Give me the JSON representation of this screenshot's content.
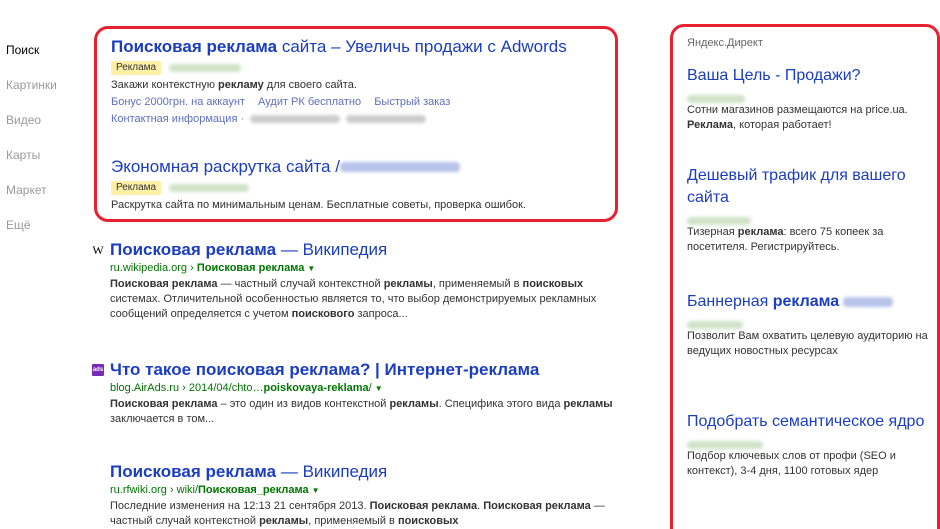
{
  "nav": {
    "items": [
      "Поиск",
      "Картинки",
      "Видео",
      "Карты",
      "Маркет",
      "Ещё"
    ]
  },
  "ads": [
    {
      "title_bold": "Поисковая реклама",
      "title_rest": " сайта – Увеличь продажи с Adwords",
      "badge": "Реклама",
      "text_pre": "Закажи контекстную ",
      "text_bold": "рекламу",
      "text_post": " для своего сайта.",
      "links": [
        "Бонус 2000грн. на аккаунт",
        "Аудит РК бесплатно",
        "Быстрый заказ"
      ],
      "contact": "Контактная информация ·"
    },
    {
      "title_rest": "Экономная раскрутка сайта / ",
      "badge": "Реклама",
      "text_plain": "Раскрутка сайта по минимальным ценам. Бесплатные советы, проверка ошибок."
    }
  ],
  "results": [
    {
      "favicon": "W",
      "title_bold": "Поисковая реклама",
      "title_rest": " — Википедия",
      "url_host": "ru.wikipedia.org",
      "url_sep": " › ",
      "url_path_bold": "Поисковая реклама",
      "snippet_1_bold": "Поисковая реклама",
      "snippet_1": " — частный случай контекстной ",
      "snippet_1b": "рекламы",
      "snippet_1c": ", применяемый в ",
      "snippet_1d": "поисковых",
      "snippet_1e": " системах. Отличительной особенностью является то, что выбор демонстрируемых рекламных сообщений определяется с учетом ",
      "snippet_1f": "поискового",
      "snippet_1g": " запроса..."
    },
    {
      "favicon": "ads",
      "title": "Что такое поисковая реклама? | Интернет-реклама",
      "url_host": "blog.AirAds.ru",
      "url_mid": " › 2014/04/chto…",
      "url_bold": "poiskovaya-reklama",
      "url_end": "/",
      "snippet_a": "Поисковая реклама",
      "snippet_b": " – это один из видов контекстной ",
      "snippet_c": "рекламы",
      "snippet_d": ". Специфика этого вида ",
      "snippet_e": "рекламы",
      "snippet_f": " заключается в том..."
    },
    {
      "title_bold": "Поисковая реклама",
      "title_rest": " — Википедия",
      "url_host": "ru.rfwiki.org",
      "url_mid": " › wiki/",
      "url_bold": "Поисковая_реклама",
      "snippet_a": "Последние изменения на 12:13 21 сентября 2013. ",
      "snippet_b": "Поисковая реклама",
      "snippet_c": ". ",
      "snippet_d": "Поисковая",
      "snippet_e": " ",
      "snippet_f": "реклама",
      "snippet_g": " — частный случай контекстной ",
      "snippet_h": "рекламы",
      "snippet_i": ", применяемый в ",
      "snippet_j": "поисковых"
    }
  ],
  "direct": {
    "header": "Яндекс.Директ",
    "ads": [
      {
        "title": "Ваша Цель - Продажи?",
        "text_a": "Сотни магазинов размещаются на price.ua. ",
        "text_b": "Реклама",
        "text_c": ", которая работает!"
      },
      {
        "title": "Дешевый трафик для вашего сайта",
        "text_a": "Тизерная ",
        "text_b": "реклама",
        "text_c": ": всего 75 копеек за посетителя. Регистрируйтесь."
      },
      {
        "title_a": "Баннерная ",
        "title_b": "реклама",
        "text_a": "Позволит Вам охватить целевую аудиторию на ведущих новостных ресурсах"
      },
      {
        "title": "Подобрать семантическое ядро",
        "text_a": "Подбор ключевых слов от профи (SEO и контекст), 3-4 дня, 1100 готовых ядер"
      }
    ]
  },
  "colors": {
    "link": "#1a3dc1",
    "url": "#007700",
    "highlight_border": "#e8202f",
    "badge": "#fff0a8"
  }
}
